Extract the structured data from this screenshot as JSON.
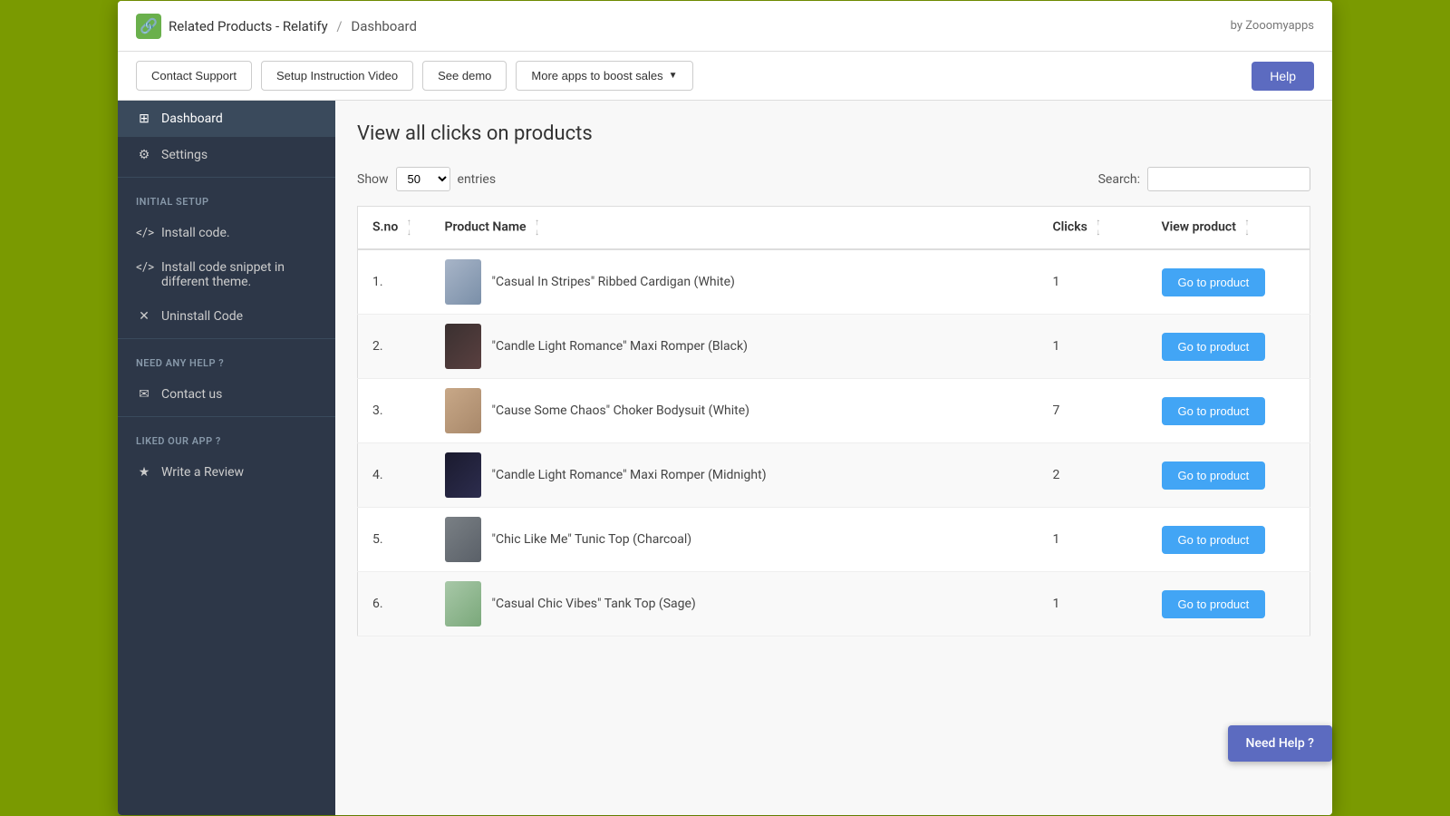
{
  "header": {
    "logo_icon": "🔗",
    "app_name": "Related Products - Relatify",
    "separator": "/",
    "page_name": "Dashboard",
    "by_text": "by Zooomyapps"
  },
  "toolbar": {
    "contact_support_label": "Contact Support",
    "setup_video_label": "Setup Instruction Video",
    "see_demo_label": "See demo",
    "more_apps_label": "More apps to boost sales",
    "help_label": "Help"
  },
  "sidebar": {
    "dashboard_label": "Dashboard",
    "settings_label": "Settings",
    "initial_setup_section": "INITIAL SETUP",
    "install_code_label": "Install code.",
    "install_snippet_label": "Install code snippet in different theme.",
    "uninstall_code_label": "Uninstall Code",
    "need_help_section": "NEED ANY HELP ?",
    "contact_us_label": "Contact us",
    "liked_app_section": "LIKED OUR APP ?",
    "write_review_label": "Write a Review"
  },
  "main": {
    "page_title": "View all clicks on products",
    "show_label": "Show",
    "entries_label": "entries",
    "search_label": "Search:",
    "show_value": "50",
    "table": {
      "headers": [
        {
          "key": "sno",
          "label": "S.no"
        },
        {
          "key": "product_name",
          "label": "Product Name"
        },
        {
          "key": "clicks",
          "label": "Clicks"
        },
        {
          "key": "view_product",
          "label": "View product"
        }
      ],
      "rows": [
        {
          "sno": "1.",
          "product_name": "\"Casual In Stripes\" Ribbed Cardigan (White)",
          "clicks": "1",
          "thumb_class": "thumb-1",
          "btn_label": "Go to product"
        },
        {
          "sno": "2.",
          "product_name": "\"Candle Light Romance\" Maxi Romper (Black)",
          "clicks": "1",
          "thumb_class": "thumb-2",
          "btn_label": "Go to product"
        },
        {
          "sno": "3.",
          "product_name": "\"Cause Some Chaos\" Choker Bodysuit (White)",
          "clicks": "7",
          "thumb_class": "thumb-3",
          "btn_label": "Go to product"
        },
        {
          "sno": "4.",
          "product_name": "\"Candle Light Romance\" Maxi Romper (Midnight)",
          "clicks": "2",
          "thumb_class": "thumb-4",
          "btn_label": "Go to product"
        },
        {
          "sno": "5.",
          "product_name": "\"Chic Like Me\" Tunic Top (Charcoal)",
          "clicks": "1",
          "thumb_class": "thumb-5",
          "btn_label": "Go to product"
        },
        {
          "sno": "6.",
          "product_name": "\"Casual Chic Vibes\" Tank Top (Sage)",
          "clicks": "1",
          "thumb_class": "thumb-6",
          "btn_label": "Go to product"
        }
      ]
    }
  },
  "need_help": {
    "label": "Need Help ?"
  }
}
